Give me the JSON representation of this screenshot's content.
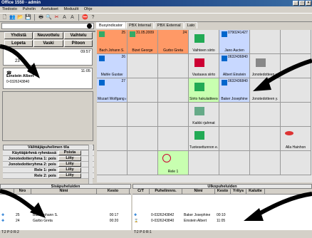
{
  "window": {
    "title": "Office 1550 - admin"
  },
  "menu": [
    "Tiedosto",
    "Puhelin",
    "Asetukset",
    "Moduulit",
    "Ohje"
  ],
  "left": {
    "buttons": [
      "Yhdistä",
      "Neuvottelu",
      "Vaihtelu",
      "Lopeta",
      "Vaski",
      "Pitoon"
    ],
    "calls": [
      {
        "time": "09:57",
        "number": "23"
      },
      {
        "time": "11:05",
        "name": "Einstein Albert",
        "number": "0-0326243840"
      }
    ],
    "status_title": "Välittäjäpuhelimen tila",
    "status_rows": [
      {
        "label": "Käyttäjärhmä ryhmässä",
        "value": "Poista"
      },
      {
        "label": "Jonotedotteryhma 1: pois",
        "value": "Liity"
      },
      {
        "label": "Jonotedotteryhma 2: pois",
        "value": "Liity"
      },
      {
        "label": "Rele 1: pois",
        "value": "Liity"
      },
      {
        "label": "Rele 2: pois",
        "value": "Liity"
      }
    ]
  },
  "tabs": [
    "Busyindicator",
    "PBX Internal",
    "PBX External",
    "Lato"
  ],
  "grid": {
    "cells": [
      {
        "name": "Bach Johann S.",
        "num": "25",
        "color": "#ff9966"
      },
      {
        "name": "Bizet George",
        "date": "31.05.2009",
        "color": "#ff9966"
      },
      {
        "name": "Gurbo Greta",
        "num": "24",
        "color": "#ff9966"
      },
      {
        "name": "Vaihteen siirto",
        "color": "#e4e4e4"
      },
      {
        "name": "Jano Aucten",
        "date": "0790241427",
        "color": "#c8d8ff"
      },
      {
        "name": "Mahle Gustav",
        "num": "26",
        "color": "#c8d8ff"
      },
      {
        "name": "Vastaava siirto",
        "color": "#e4e4e4"
      },
      {
        "name": "Albert Einstein",
        "date": "0632436840",
        "color": "#c8d8ff"
      },
      {
        "name": "Jonotedotteen y.",
        "color": "#e4e4e4"
      },
      {
        "name": "Mozart Wolfgang A.",
        "num": "27",
        "color": "#c8d8ff"
      },
      {
        "name": "Siirto hakulaitteesen",
        "color": "#c8ffb0"
      },
      {
        "name": "Baker Josephine",
        "date": "0632436840",
        "color": "#c8d8ff"
      },
      {
        "name": "Jonotedotteen y.",
        "color": "#e4e4e4"
      },
      {
        "name": "Kaikki rjahmat",
        "color": "#e4e4e4"
      },
      {
        "name": "Tuotesettunnon e.",
        "color": "#e4e4e4"
      },
      {
        "name": "Alla Hainhon",
        "color": "#e4e4e4"
      },
      {
        "name": "Rele 1",
        "color": "#c8ffb0"
      }
    ]
  },
  "queue": {
    "title": "Sisäpuheluiden",
    "headers": [
      "Nro",
      "Nimi",
      "Kesto"
    ],
    "rows": [
      {
        "nro": "25",
        "name": "Bach Johann S.",
        "duration": "00:17"
      },
      {
        "nro": "24",
        "name": "Garbo Greta",
        "duration": "00:20"
      }
    ],
    "status": "T:2 P:0 R:2"
  },
  "outgoing": {
    "title": "Ulkopuheluiden",
    "headers": [
      "C/T",
      "Puhelinnro.",
      "Nimi",
      "Kesto",
      "Yritys",
      "Kalutte"
    ],
    "rows": [
      {
        "number": "0-0326243842",
        "name": "Baker Josephine",
        "duration": "00:10"
      },
      {
        "number": "0-0326243840",
        "name": "Einstein Albert",
        "duration": "11:05"
      }
    ],
    "status": "T:2 P:0 R:1"
  },
  "colors": {
    "accent": "#0a246a",
    "orange": "#ff9966",
    "blue": "#c8d8ff",
    "green": "#c8ffb0"
  }
}
